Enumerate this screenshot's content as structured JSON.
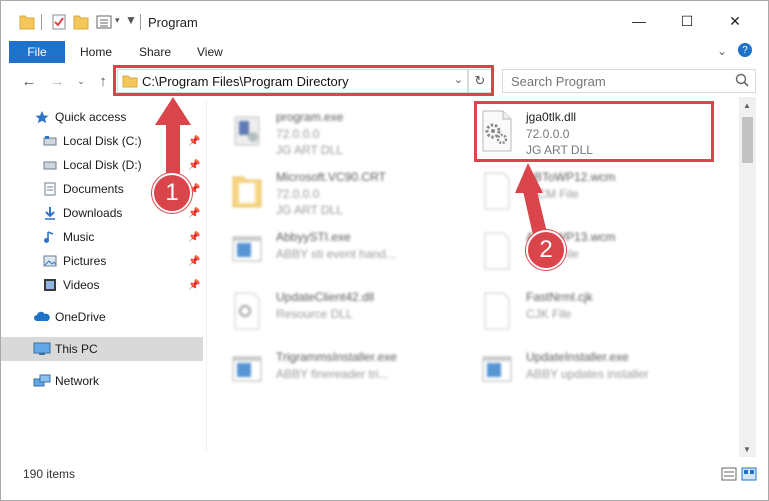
{
  "window": {
    "title": "Program",
    "minimize": "—",
    "maximize": "☐",
    "close": "✕"
  },
  "ribbon": {
    "tabs": [
      "File",
      "Home",
      "Share",
      "View"
    ]
  },
  "address": {
    "path": "C:\\Program Files\\Program Directory"
  },
  "search": {
    "placeholder": "Search Program"
  },
  "sidebar": {
    "items": [
      {
        "label": "Quick access",
        "icon": "star-icon"
      },
      {
        "label": "Local Disk (C:)",
        "icon": "drive-icon"
      },
      {
        "label": "Local Disk (D:)",
        "icon": "drive-icon"
      },
      {
        "label": "Documents",
        "icon": "documents-icon"
      },
      {
        "label": "Downloads",
        "icon": "download-icon"
      },
      {
        "label": "Music",
        "icon": "music-icon"
      },
      {
        "label": "Pictures",
        "icon": "pictures-icon"
      },
      {
        "label": "Videos",
        "icon": "videos-icon"
      },
      {
        "label": "OneDrive",
        "icon": "cloud-icon"
      },
      {
        "label": "This PC",
        "icon": "computer-icon"
      },
      {
        "label": "Network",
        "icon": "network-icon"
      }
    ]
  },
  "files": [
    {
      "name": "program.exe",
      "line1": "72.0.0.0",
      "line2": "JG ART DLL"
    },
    {
      "name": "jga0tlk.dll",
      "line1": "72.0.0.0",
      "line2": "JG ART DLL"
    },
    {
      "name": "Microsoft.VC90.CRT",
      "line1": "72.0.0.0",
      "line2": "JG ART DLL"
    },
    {
      "name": "ABToWP12.wcm",
      "line1": "WCM File",
      "line2": ""
    },
    {
      "name": "AbbyySTI.exe",
      "line1": "ABBY sti event hand...",
      "line2": ""
    },
    {
      "name": "ABToWP13.wcm",
      "line1": "WCM File",
      "line2": ""
    },
    {
      "name": "UpdateClient42.dll",
      "line1": "Resource DLL",
      "line2": ""
    },
    {
      "name": "FastNrml.cjk",
      "line1": "CJK File",
      "line2": ""
    },
    {
      "name": "TrigrammsInstaller.exe",
      "line1": "ABBY finereader tri...",
      "line2": ""
    },
    {
      "name": "UpdateInstaller.exe",
      "line1": "ABBY updates installer",
      "line2": ""
    }
  ],
  "status": {
    "count": "190 items"
  },
  "callouts": [
    "1",
    "2"
  ],
  "colors": {
    "accent": "#1e73c8",
    "highlight": "#d9454a",
    "selected": "#d9d9d9"
  }
}
